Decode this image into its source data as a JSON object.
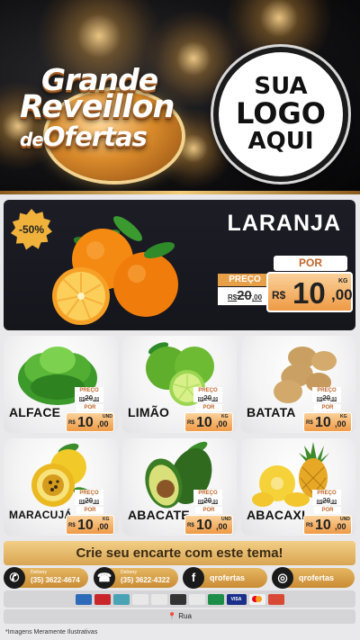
{
  "header": {
    "title_line1": "Grande",
    "title_line2": "Reveillon",
    "title_de": "de",
    "title_line3": "Ofertas",
    "logo_line1": "SUA",
    "logo_line2": "LOGO",
    "logo_line3": "AQUI"
  },
  "featured": {
    "discount": "-50%",
    "name": "LARANJA",
    "por_label": "POR",
    "preco_label": "PREÇO",
    "old_currency": "R$",
    "old_int": "20",
    "old_dec": ",00",
    "currency": "R$",
    "price_int": "10",
    "price_dec": ",00",
    "unit": "KG"
  },
  "products": [
    {
      "name": "ALFACE",
      "preco_label": "PREÇO",
      "old_prefix": "R$",
      "old_price": "20",
      "old_dec": ",00",
      "por_label": "POR",
      "currency": "R$",
      "price_int": "10",
      "price_dec": ",00",
      "unit": "UND"
    },
    {
      "name": "LIMÃO",
      "preco_label": "PREÇO",
      "old_prefix": "R$",
      "old_price": "20",
      "old_dec": ",00",
      "por_label": "POR",
      "currency": "R$",
      "price_int": "10",
      "price_dec": ",00",
      "unit": "KG"
    },
    {
      "name": "BATATA",
      "preco_label": "PREÇO",
      "old_prefix": "R$",
      "old_price": "20",
      "old_dec": ",00",
      "por_label": "POR",
      "currency": "R$",
      "price_int": "10",
      "price_dec": ",00",
      "unit": "KG"
    },
    {
      "name": "MARACUJÁ",
      "preco_label": "PREÇO",
      "old_prefix": "R$",
      "old_price": "20",
      "old_dec": ",00",
      "por_label": "POR",
      "currency": "R$",
      "price_int": "10",
      "price_dec": ",00",
      "unit": "KG"
    },
    {
      "name": "ABACATE",
      "preco_label": "PREÇO",
      "old_prefix": "R$",
      "old_price": "20",
      "old_dec": ",00",
      "por_label": "POR",
      "currency": "R$",
      "price_int": "10",
      "price_dec": ",00",
      "unit": "UND"
    },
    {
      "name": "ABACAXI",
      "preco_label": "PREÇO",
      "old_prefix": "R$",
      "old_price": "20",
      "old_dec": ",00",
      "por_label": "POR",
      "currency": "R$",
      "price_int": "10",
      "price_dec": ",00",
      "unit": "UND"
    }
  ],
  "footer": {
    "cta": "Crie seu encarte com este tema!",
    "whatsapp_label": "Delivery",
    "whatsapp_number": "(35) 3622-4674",
    "phone_label": "Delivery",
    "phone_number": "(35) 3622-4322",
    "facebook": "qrofertas",
    "instagram": "qrofertas",
    "address": "Rua",
    "disclaimer": "*Imagens Meramente Ilustrativas",
    "payments": [
      {
        "label": "",
        "color": "#2d6bb8",
        "icon": "card-icon"
      },
      {
        "label": "",
        "color": "#c8262b",
        "icon": "card-icon"
      },
      {
        "label": "",
        "color": "#4aa3b5",
        "icon": "card-icon"
      },
      {
        "label": "",
        "color": "#e8e8e8",
        "icon": "card-icon"
      },
      {
        "label": "",
        "color": "#e8e8e8",
        "icon": "card-icon"
      },
      {
        "label": "",
        "color": "#333333",
        "icon": "card-icon"
      },
      {
        "label": "",
        "color": "#e8e8e8",
        "icon": "card-icon"
      },
      {
        "label": "",
        "color": "#1c8e49",
        "icon": "card-icon"
      },
      {
        "label": "VISA",
        "color": "#1a2f8a",
        "icon": "visa-icon"
      },
      {
        "label": "",
        "color": "#f2f2f2",
        "icon": "mastercard-icon"
      },
      {
        "label": "",
        "color": "#d94a36",
        "icon": "hipercard-icon"
      }
    ]
  },
  "colors": {
    "gold": "#e6b661",
    "orange_price": "#ee9a45",
    "dark_panel": "#1d1d26"
  }
}
